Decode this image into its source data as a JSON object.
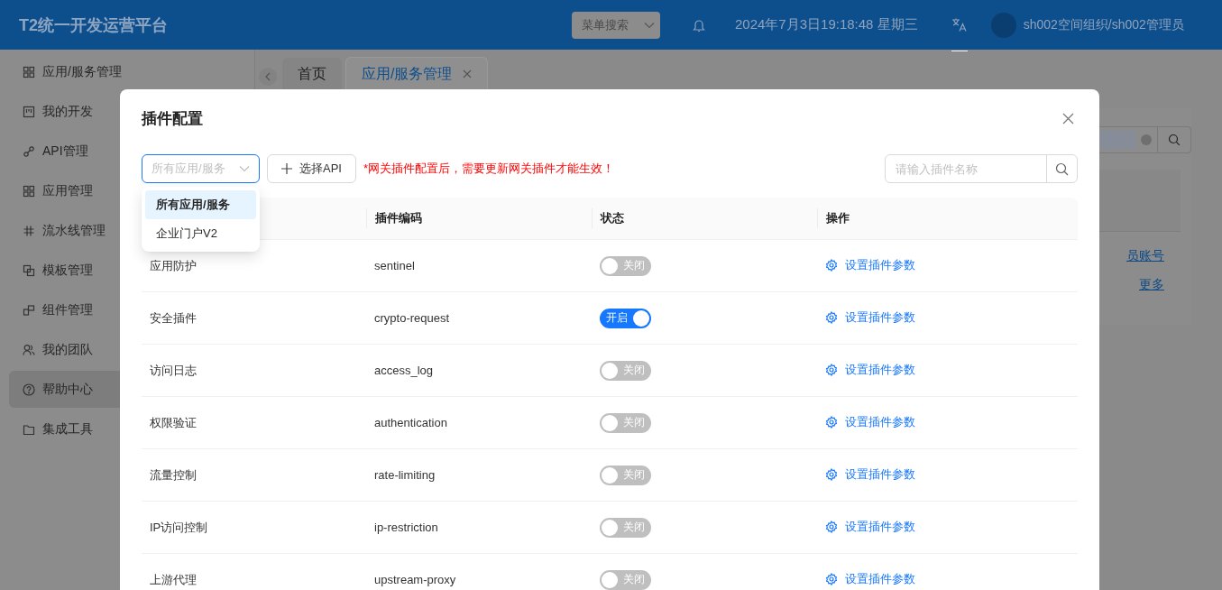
{
  "header": {
    "title": "T2统一开发运营平台",
    "menu_search": {
      "placeholder": "菜单搜索"
    },
    "datetime": "2024年7月3日19:18:48 星期三",
    "user": "sh002空间组织/sh002管理员"
  },
  "sidebar": {
    "items": [
      {
        "label": "应用/服务管理",
        "selected": false
      },
      {
        "label": "我的开发",
        "selected": false
      },
      {
        "label": "API管理",
        "selected": false
      },
      {
        "label": "应用管理",
        "selected": false
      },
      {
        "label": "流水线管理",
        "selected": false
      },
      {
        "label": "模板管理",
        "selected": false
      },
      {
        "label": "组件管理",
        "selected": false
      },
      {
        "label": "我的团队",
        "selected": false
      },
      {
        "label": "帮助中心",
        "selected": true
      },
      {
        "label": "集成工具",
        "selected": false
      }
    ]
  },
  "tabs": [
    {
      "label": "首页",
      "selected": false,
      "closable": false
    },
    {
      "label": "应用/服务管理",
      "selected": true,
      "closable": true
    }
  ],
  "background_links": [
    "员账号",
    "更多"
  ],
  "dialog": {
    "title": "插件配置",
    "app_select": {
      "placeholder": "所有应用/服务",
      "options": [
        {
          "label": "所有应用/服务",
          "selected": true
        },
        {
          "label": "企业门户V2",
          "selected": false
        }
      ]
    },
    "add_button": "选择API",
    "notice": "*网关插件配置后，需要更新网关插件才能生效！",
    "search": {
      "placeholder": "请输入插件名称"
    },
    "columns": [
      "插件编码",
      "状态",
      "操作"
    ],
    "rows": [
      {
        "name": "应用防护",
        "code": "sentinel",
        "enabled": false,
        "status": "关闭",
        "action": "设置插件参数"
      },
      {
        "name": "安全插件",
        "code": "crypto-request",
        "enabled": true,
        "status": "开启",
        "action": "设置插件参数"
      },
      {
        "name": "访问日志",
        "code": "access_log",
        "enabled": false,
        "status": "关闭",
        "action": "设置插件参数"
      },
      {
        "name": "权限验证",
        "code": "authentication",
        "enabled": false,
        "status": "关闭",
        "action": "设置插件参数"
      },
      {
        "name": "流量控制",
        "code": "rate-limiting",
        "enabled": false,
        "status": "关闭",
        "action": "设置插件参数"
      },
      {
        "name": "IP访问控制",
        "code": "ip-restriction",
        "enabled": false,
        "status": "关闭",
        "action": "设置插件参数"
      },
      {
        "name": "上游代理",
        "code": "upstream-proxy",
        "enabled": false,
        "status": "关闭",
        "action": "设置插件参数"
      }
    ]
  }
}
